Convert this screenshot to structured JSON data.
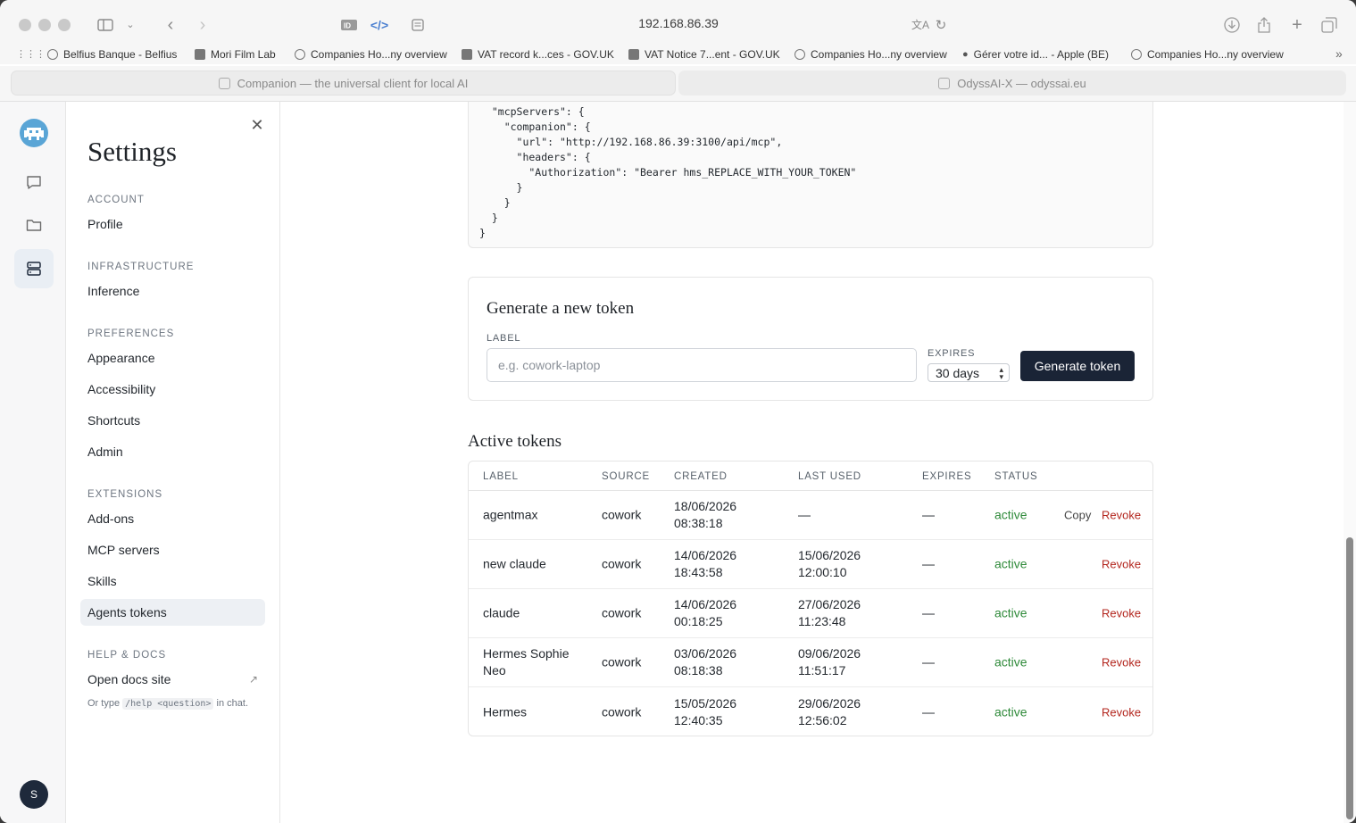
{
  "browser": {
    "address": "192.168.86.39",
    "bookmarks": [
      "Belfius Banque - Belfius",
      "Mori Film Lab",
      "Companies Ho...ny overview",
      "VAT record k...ces - GOV.UK",
      "VAT Notice 7...ent - GOV.UK",
      "Companies Ho...ny overview",
      "Gérer votre id... - Apple (BE)",
      "Companies Ho...ny overview"
    ],
    "tabs": [
      "Companion — the universal client for local AI",
      "OdyssAI-X — odyssai.eu"
    ]
  },
  "rail": {
    "avatar_initial": "S"
  },
  "settings": {
    "title": "Settings",
    "sections": [
      {
        "label": "ACCOUNT",
        "items": [
          "Profile"
        ]
      },
      {
        "label": "INFRASTRUCTURE",
        "items": [
          "Inference"
        ]
      },
      {
        "label": "PREFERENCES",
        "items": [
          "Appearance",
          "Accessibility",
          "Shortcuts",
          "Admin"
        ]
      },
      {
        "label": "EXTENSIONS",
        "items": [
          "Add-ons",
          "MCP servers",
          "Skills",
          "Agents tokens"
        ]
      },
      {
        "label": "HELP & DOCS",
        "items": [
          "Open docs site"
        ]
      }
    ],
    "hint_prefix": "Or type",
    "hint_code": "/help <question>",
    "hint_suffix": "in chat."
  },
  "config_snippet": "  \"mcpServers\": {\n    \"companion\": {\n      \"url\": \"http://192.168.86.39:3100/api/mcp\",\n      \"headers\": {\n        \"Authorization\": \"Bearer hms_REPLACE_WITH_YOUR_TOKEN\"\n      }\n    }\n  }\n}",
  "generate": {
    "title": "Generate a new token",
    "label_caption": "LABEL",
    "label_placeholder": "e.g. cowork-laptop",
    "expires_caption": "EXPIRES",
    "expires_value": "30 days",
    "button": "Generate token"
  },
  "active_tokens": {
    "title": "Active tokens",
    "headers": [
      "LABEL",
      "SOURCE",
      "CREATED",
      "LAST USED",
      "EXPIRES",
      "STATUS"
    ],
    "rows": [
      {
        "label": "agentmax",
        "source": "cowork",
        "created_date": "18/06/2026",
        "created_time": "08:38:18",
        "last_used_date": "—",
        "last_used_time": "",
        "expires": "—",
        "status": "active",
        "copy": "Copy",
        "revoke": "Revoke"
      },
      {
        "label": "new claude",
        "source": "cowork",
        "created_date": "14/06/2026",
        "created_time": "18:43:58",
        "last_used_date": "15/06/2026",
        "last_used_time": "12:00:10",
        "expires": "—",
        "status": "active",
        "copy": "",
        "revoke": "Revoke"
      },
      {
        "label": "claude",
        "source": "cowork",
        "created_date": "14/06/2026",
        "created_time": "00:18:25",
        "last_used_date": "27/06/2026",
        "last_used_time": "11:23:48",
        "expires": "—",
        "status": "active",
        "copy": "",
        "revoke": "Revoke"
      },
      {
        "label": "Hermes Sophie Neo",
        "source": "cowork",
        "created_date": "03/06/2026",
        "created_time": "08:18:38",
        "last_used_date": "09/06/2026",
        "last_used_time": "11:51:17",
        "expires": "—",
        "status": "active",
        "copy": "",
        "revoke": "Revoke"
      },
      {
        "label": "Hermes",
        "source": "cowork",
        "created_date": "15/05/2026",
        "created_time": "12:40:35",
        "last_used_date": "29/06/2026",
        "last_used_time": "12:56:02",
        "expires": "—",
        "status": "active",
        "copy": "",
        "revoke": "Revoke"
      }
    ]
  }
}
